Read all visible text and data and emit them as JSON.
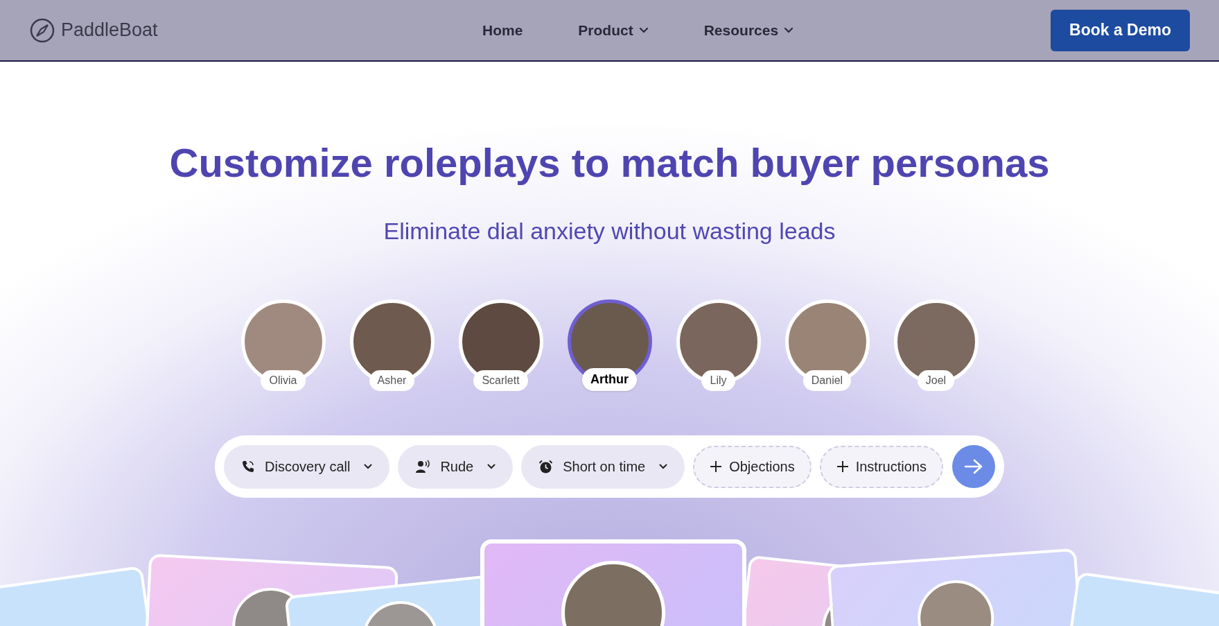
{
  "header": {
    "logo": "PaddleBoat",
    "nav": [
      {
        "label": "Home",
        "dropdown": false
      },
      {
        "label": "Product",
        "dropdown": true
      },
      {
        "label": "Resources",
        "dropdown": true
      }
    ],
    "cta": "Book a Demo"
  },
  "hero": {
    "title": "Customize roleplays to match buyer personas",
    "subtitle": "Eliminate dial anxiety without wasting leads"
  },
  "personas": [
    {
      "name": "Olivia",
      "selected": false
    },
    {
      "name": "Asher",
      "selected": false
    },
    {
      "name": "Scarlett",
      "selected": false
    },
    {
      "name": "Arthur",
      "selected": true
    },
    {
      "name": "Lily",
      "selected": false
    },
    {
      "name": "Daniel",
      "selected": false
    },
    {
      "name": "Joel",
      "selected": false
    }
  ],
  "options": [
    {
      "kind": "dropdown",
      "label": "Discovery call"
    },
    {
      "kind": "dropdown",
      "label": "Rude"
    },
    {
      "kind": "dropdown",
      "label": "Short on time"
    },
    {
      "kind": "add",
      "label": "Objections"
    },
    {
      "kind": "add",
      "label": "Instructions"
    }
  ]
}
